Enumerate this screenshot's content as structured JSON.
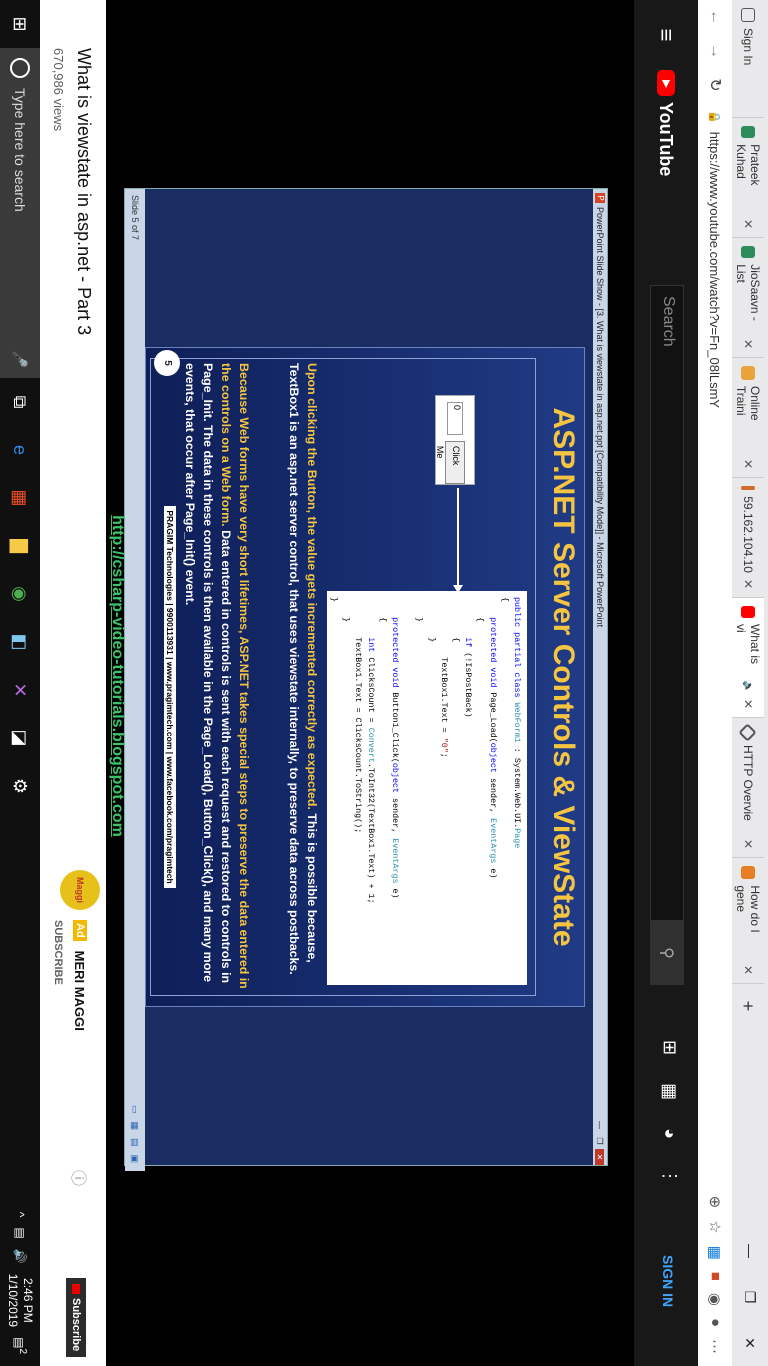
{
  "browser": {
    "tabs": [
      {
        "label": "Sign In",
        "color": "#e9e9eb"
      },
      {
        "label": "Prateek Kuhad",
        "color": "#2c8c5a"
      },
      {
        "label": "JioSaavn - List",
        "color": "#2c8c5a"
      },
      {
        "label": "Online Traini",
        "color": "#e8a33d"
      },
      {
        "label": "59.162.104.10",
        "color": "#d36a2a"
      },
      {
        "label": "What is vi",
        "color": "#f00"
      },
      {
        "label": "HTTP Overvie",
        "color": "#555"
      },
      {
        "label": "How do I gene",
        "color": "#e87f24"
      }
    ],
    "url": "https://www.youtube.com/watch?v=Fn_08lLsmY"
  },
  "youtube": {
    "logo_text": "YouTube",
    "search_placeholder": "Search",
    "sign_in": "SIGN IN"
  },
  "ppt": {
    "window_title": "PowerPoint Slide Show - [3. What is viewstate in asp.net.ppt [Compatibility Mode]] - Microsoft PowerPoint",
    "status": "Slide 5 of 7",
    "slide": {
      "title": "ASP.NET Server Controls & ViewState",
      "textbox_value": "0",
      "button_label": "Click Me",
      "p1_highlight": "Upon clicking the Button, the value gets incremented correctly as expected.",
      "p1_rest": " This is possible because, TextBox1 is an asp.net server control, that uses viewstate internally, to preserve data across postbacks.",
      "p2_highlight": "Because Web forms have very short lifetimes, ASP.NET takes special steps to preserve the data entered in the controls on a Web form.",
      "p2_rest": " Data entered in controls is sent with each request and restored to controls in Page_Init. The data in these controls is then available in the Page_Load(), Button_Click(), and many more events, that occur after Page_Init() event.",
      "number": "5",
      "footer": "PRAGIM Technologies | 9900113931 | www.pragimtech.com | www.facebook.com/pragimtech",
      "link": "http://csharp-video-tutorials.blogspot.com"
    }
  },
  "video": {
    "title": "What is viewstate in asp.net - Part 3",
    "views": "670,986 views"
  },
  "ad": {
    "badge": "Ad",
    "name": "MERI MAGGI",
    "logo": "Maggi",
    "sub": "SUBSCRIBE"
  },
  "subscribe": "Subscribe",
  "taskbar": {
    "search_placeholder": "Type here to search",
    "time": "2:46 PM",
    "date": "1/10/2019",
    "notif": "2"
  }
}
